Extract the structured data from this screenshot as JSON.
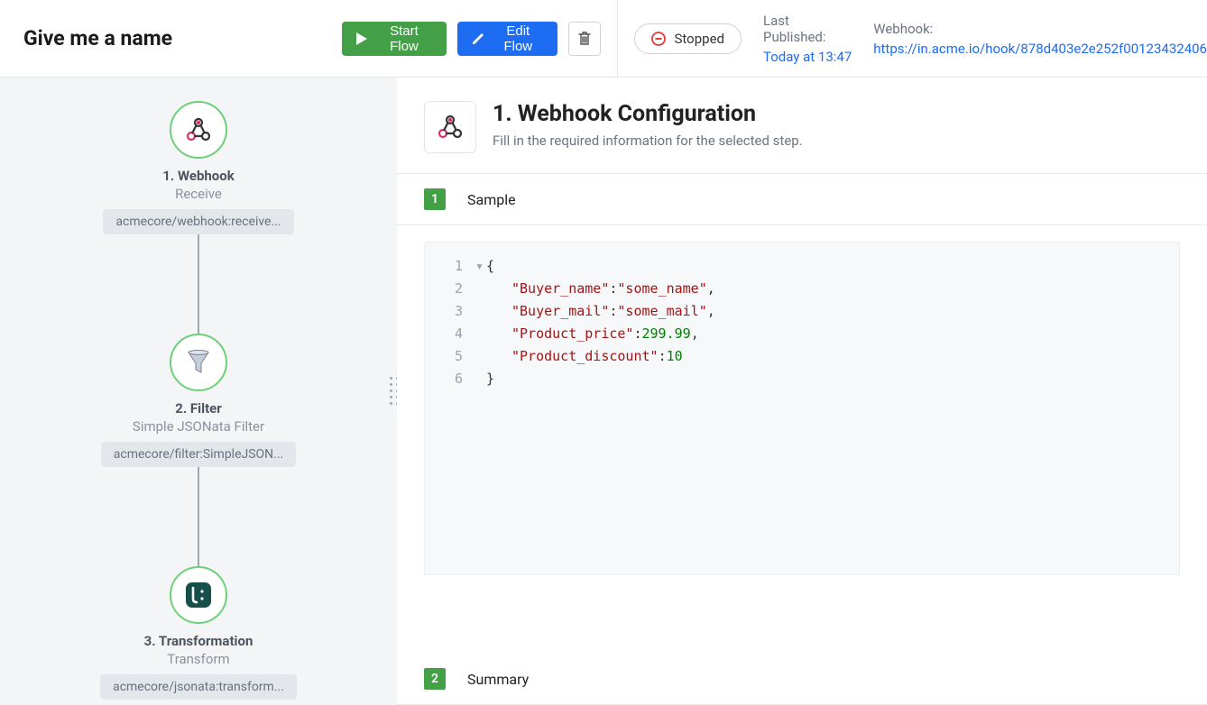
{
  "title": "Give me a name",
  "toolbar": {
    "start_label": "Start Flow",
    "edit_label": "Edit Flow"
  },
  "status": {
    "label": "Stopped"
  },
  "meta": {
    "published_label": "Last Published:",
    "published_value": "Today at 13:47",
    "webhook_label": "Webhook:",
    "webhook_url": "https://in.acme.io/hook/878d403e2e252f00123432406"
  },
  "flow_nodes": [
    {
      "title": "1. Webhook",
      "subtitle": "Receive",
      "tag": "acmecore/webhook:receive..."
    },
    {
      "title": "2. Filter",
      "subtitle": "Simple JSONata Filter",
      "tag": "acmecore/filter:SimpleJSON..."
    },
    {
      "title": "3. Transformation",
      "subtitle": "Transform",
      "tag": "acmecore/jsonata:transform..."
    }
  ],
  "panel": {
    "heading": "1. Webhook Configuration",
    "desc": "Fill in the required information for the selected step.",
    "sections": [
      {
        "num": "1",
        "title": "Sample"
      },
      {
        "num": "2",
        "title": "Summary"
      }
    ]
  },
  "code": {
    "l1": "{",
    "k2": "\"Buyer_name\"",
    "v2": "\"some_name\"",
    "k3": "\"Buyer_mail\"",
    "v3": "\"some_mail\"",
    "k4": "\"Product_price\"",
    "v4": "299.99",
    "k5": "\"Product_discount\"",
    "v5": "10",
    "l6": "}"
  }
}
